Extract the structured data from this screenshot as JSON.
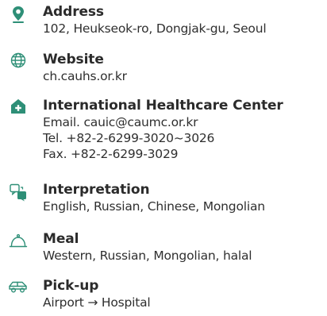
{
  "colors": {
    "accent": "#2e8f77",
    "outline": "#2e8f77",
    "text": "#2b2b2b"
  },
  "items": [
    {
      "icon": "map-pin-icon",
      "title": "Address",
      "lines": [
        "102, Heukseok-ro, Dongjak-gu, Seoul"
      ]
    },
    {
      "icon": "globe-icon",
      "title": "Website",
      "lines": [
        "ch.cauhs.or.kr"
      ]
    },
    {
      "icon": "hospital-house-icon",
      "title": "International Healthcare Center",
      "lines": [
        "Email. cauic@caumc.or.kr",
        "Tel. +82-2-6299-3020~3026",
        "Fax. +82-2-6299-3029"
      ]
    },
    {
      "icon": "translate-icon",
      "title": "Interpretation",
      "lines": [
        "English, Russian, Chinese, Mongolian"
      ]
    },
    {
      "icon": "cloche-icon",
      "title": "Meal",
      "lines": [
        "Western, Russian, Mongolian, halal"
      ]
    },
    {
      "icon": "car-icon",
      "title": "Pick-up",
      "lines": [
        "Airport → Hospital"
      ]
    }
  ]
}
